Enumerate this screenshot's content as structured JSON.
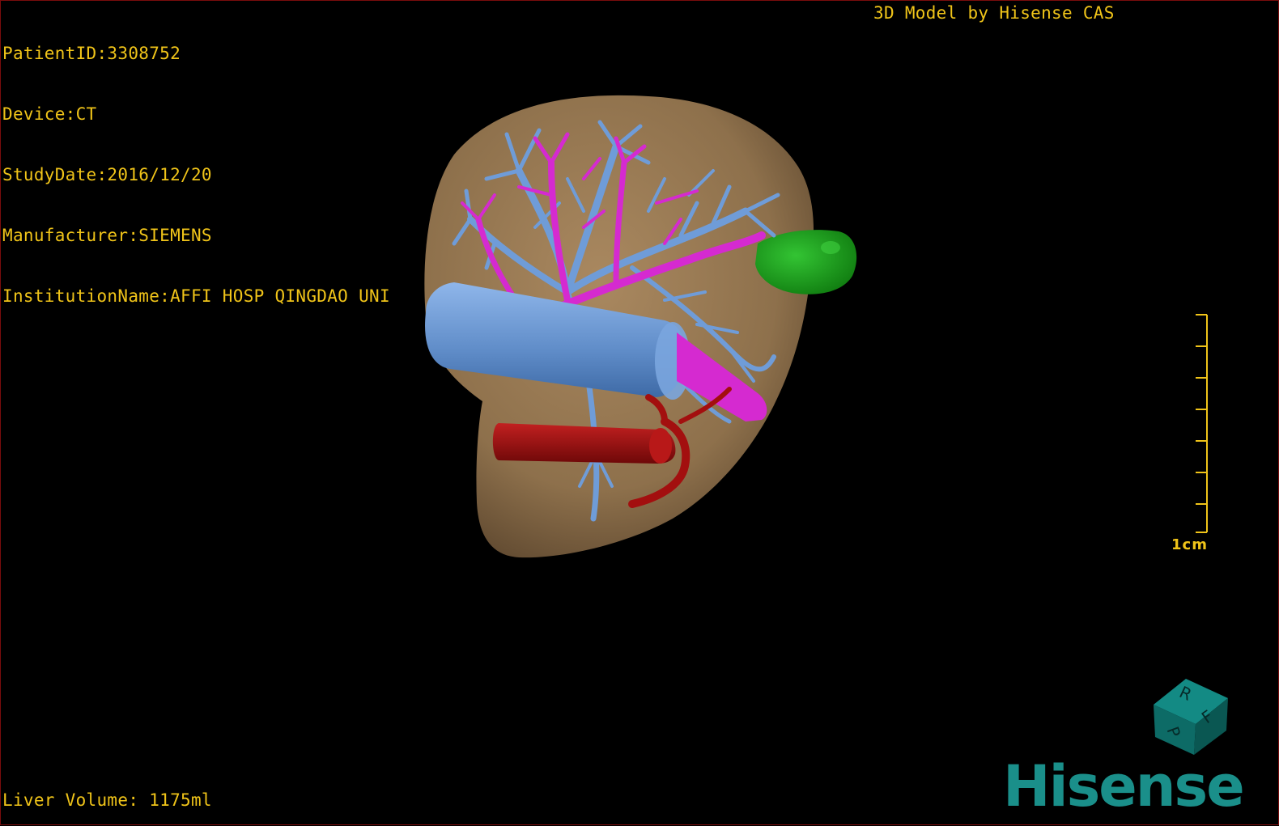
{
  "patient_info": {
    "lines": [
      "PatientID:3308752",
      "Device:CT",
      "StudyDate:2016/12/20",
      "Manufacturer:SIEMENS",
      "InstitutionName:AFFI HOSP QINGDAO UNI"
    ]
  },
  "header": {
    "model_title": "3D Model by Hisense CAS"
  },
  "footer": {
    "liver_volume": "Liver Volume: 1175ml"
  },
  "scale": {
    "label": "1cm",
    "color": "#f0c419"
  },
  "orientation_cube": {
    "faces": [
      "R",
      "F",
      "P"
    ],
    "color": "#0d6b66"
  },
  "brand": {
    "name": "Hisense",
    "color": "#1a8f8a"
  },
  "colors": {
    "text": "#f0c419",
    "liver": "#a5845a",
    "portal_vein": "#6f9cd8",
    "hepatic_vein": "#d52ad0",
    "artery": "#a30f0f",
    "gallbladder": "#1ea51e"
  }
}
